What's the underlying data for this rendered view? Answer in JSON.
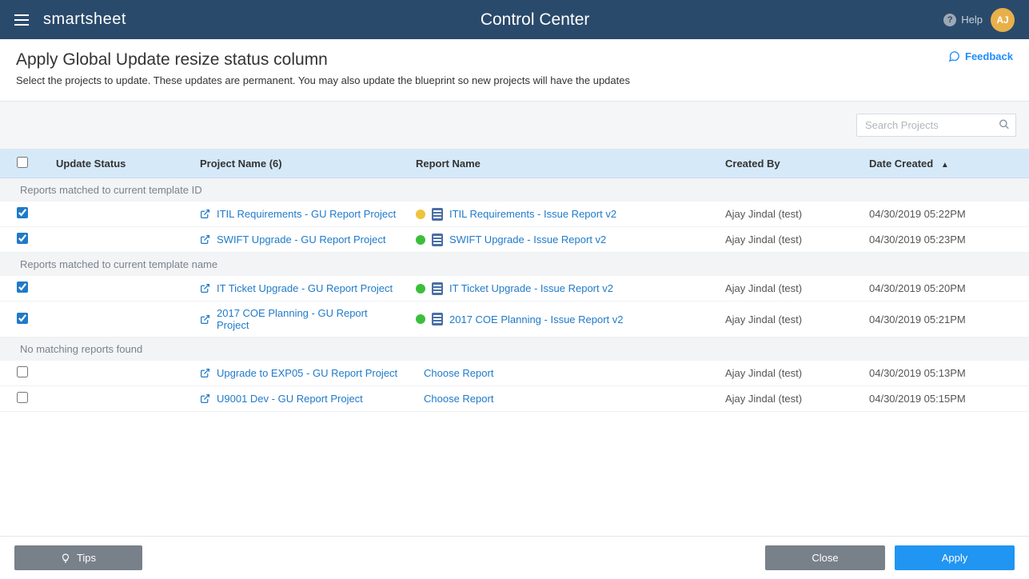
{
  "topbar": {
    "brand": "smartsheet",
    "title": "Control Center",
    "help": "Help",
    "avatar_initials": "AJ"
  },
  "subheader": {
    "title": "Apply Global Update resize status column",
    "subtitle": "Select the projects to update. These updates are permanent. You may also update the blueprint so new projects will have the updates",
    "feedback": "Feedback"
  },
  "search": {
    "placeholder": "Search Projects"
  },
  "columns": {
    "update_status": "Update Status",
    "project_name": "Project Name (6)",
    "report_name": "Report Name",
    "created_by": "Created By",
    "date_created": "Date Created"
  },
  "groups": {
    "g1": "Reports matched to current template ID",
    "g2": "Reports matched to current template name",
    "g3": "No matching reports found"
  },
  "rows": {
    "r1": {
      "checked": true,
      "project": "ITIL Requirements - GU Report Project",
      "dot": "yellow",
      "report": "ITIL Requirements - Issue Report v2",
      "has_report": true,
      "created_by": "Ajay Jindal (test)",
      "date": "04/30/2019 05:22PM"
    },
    "r2": {
      "checked": true,
      "project": "SWIFT Upgrade - GU Report Project",
      "dot": "green",
      "report": "SWIFT Upgrade - Issue Report v2",
      "has_report": true,
      "created_by": "Ajay Jindal (test)",
      "date": "04/30/2019 05:23PM"
    },
    "r3": {
      "checked": true,
      "project": "IT Ticket Upgrade - GU Report Project",
      "dot": "green",
      "report": "IT Ticket Upgrade - Issue Report v2",
      "has_report": true,
      "created_by": "Ajay Jindal (test)",
      "date": "04/30/2019 05:20PM"
    },
    "r4": {
      "checked": true,
      "project": "2017 COE Planning - GU Report Project",
      "dot": "green",
      "report": "2017 COE Planning - Issue Report v2",
      "has_report": true,
      "created_by": "Ajay Jindal (test)",
      "date": "04/30/2019 05:21PM"
    },
    "r5": {
      "checked": false,
      "project": "Upgrade to EXP05 - GU Report Project",
      "dot": "",
      "report": "Choose Report",
      "has_report": false,
      "created_by": "Ajay Jindal (test)",
      "date": "04/30/2019 05:13PM"
    },
    "r6": {
      "checked": false,
      "project": "U9001 Dev - GU Report Project",
      "dot": "",
      "report": "Choose Report",
      "has_report": false,
      "created_by": "Ajay Jindal (test)",
      "date": "04/30/2019 05:15PM"
    }
  },
  "footer": {
    "tips": "Tips",
    "close": "Close",
    "apply": "Apply"
  }
}
